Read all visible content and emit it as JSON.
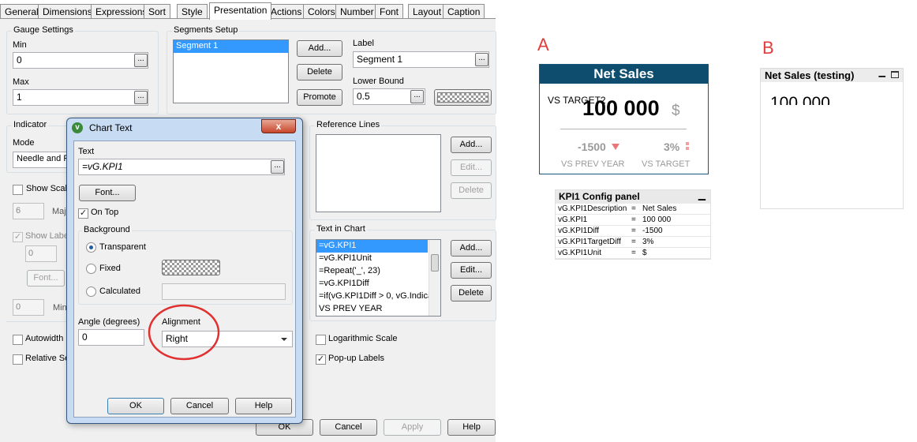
{
  "tabs": [
    "General",
    "Dimensions",
    "Expressions",
    "Sort",
    "Style",
    "Presentation",
    "Actions",
    "Colors",
    "Number",
    "Font",
    "Layout",
    "Caption"
  ],
  "active_tab": "Presentation",
  "gauge_settings": {
    "title": "Gauge Settings",
    "min_label": "Min",
    "min_value": "0",
    "max_label": "Max",
    "max_value": "1"
  },
  "segments_setup": {
    "title": "Segments Setup",
    "segments": [
      "Segment 1"
    ],
    "add_label": "Add...",
    "delete_label": "Delete",
    "promote_label": "Promote",
    "label_caption": "Label",
    "label_value": "Segment 1",
    "lower_bound_caption": "Lower Bound",
    "lower_bound_value": "0.5"
  },
  "indicator": {
    "title": "Indicator",
    "mode_label": "Mode",
    "mode_value": "Needle and F"
  },
  "show_scale": {
    "label": "Show Scal",
    "major_value": "6",
    "major_label": "Maj",
    "show_labels_label": "Show Label",
    "labels_value": "0",
    "font_label": "Font...",
    "min_value": "0",
    "min_label": "Min"
  },
  "reference_lines": {
    "title": "Reference Lines",
    "add_label": "Add...",
    "edit_label": "Edit...",
    "delete_label": "Delete"
  },
  "text_in_chart": {
    "title": "Text in Chart",
    "items": [
      "=vG.KPI1",
      "=vG.KPI1Unit",
      "=Repeat('_', 23)",
      "=vG.KPI1Diff",
      "=if(vG.KPI1Diff > 0, vG.Indica",
      "VS PREV YEAR"
    ],
    "add_label": "Add...",
    "edit_label": "Edit...",
    "delete_label": "Delete"
  },
  "bottom_checks": {
    "autowidth": "Autowidth",
    "relative": "Relative Se",
    "log_scale": "Logarithmic Scale",
    "popup_labels": "Pop-up Labels"
  },
  "footer_buttons": {
    "ok": "OK",
    "cancel": "Cancel",
    "apply": "Apply",
    "help": "Help"
  },
  "chart_text_dialog": {
    "title": "Chart Text",
    "close": "x",
    "text_label": "Text",
    "text_value": "=vG.KPI1",
    "font_button": "Font...",
    "on_top_label": "On Top",
    "background_label": "Background",
    "bg_transparent": "Transparent",
    "bg_fixed": "Fixed",
    "bg_calculated": "Calculated",
    "angle_label": "Angle (degrees)",
    "angle_value": "0",
    "alignment_label": "Alignment",
    "alignment_value": "Right",
    "ok": "OK",
    "cancel": "Cancel",
    "help": "Help"
  },
  "kpi_a": {
    "letter": "A",
    "title": "Net Sales",
    "overlay_text": "VS TARGET2",
    "value": "100 000",
    "unit": "$",
    "prev_diff": "-1500",
    "target_diff": "3%",
    "prev_label": "VS PREV YEAR",
    "target_label": "VS TARGET"
  },
  "config_panel": {
    "title": "KPI1 Config panel",
    "rows": [
      {
        "name": "vG.KPI1Description",
        "value": "Net Sales"
      },
      {
        "name": "vG.KPI1",
        "value": "100 000"
      },
      {
        "name": "vG.KPI1Diff",
        "value": "-1500"
      },
      {
        "name": "vG.KPI1TargetDiff",
        "value": "3%"
      },
      {
        "name": "vG.KPI1Unit",
        "value": "$"
      }
    ]
  },
  "kpi_b": {
    "letter": "B",
    "title": "Net Sales (testing)",
    "value": "100 000"
  },
  "colors": {
    "kpi_header": "#0f4d6e",
    "annotation_red": "#e23b3b",
    "selection_blue": "#3399ff",
    "down_arrow": "#e87878"
  }
}
